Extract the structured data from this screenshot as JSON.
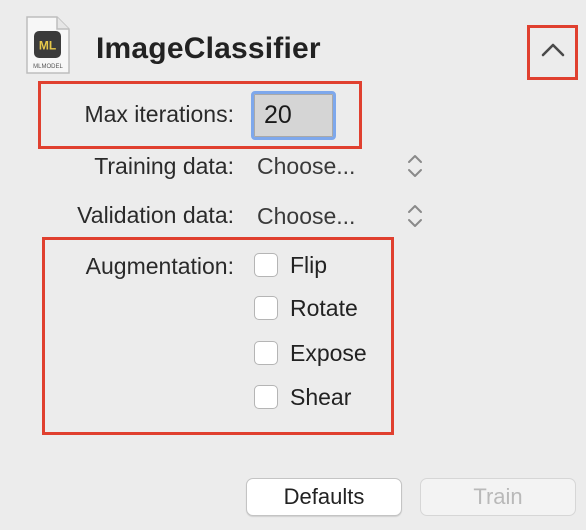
{
  "header": {
    "file_icon_badge": "ML",
    "file_icon_caption": "MLMODEL",
    "title": "ImageClassifier",
    "collapse_icon": "chevron-up-icon"
  },
  "form": {
    "max_iterations": {
      "label": "Max iterations:",
      "value": "20"
    },
    "training_data": {
      "label": "Training data:",
      "value": "Choose..."
    },
    "validation_data": {
      "label": "Validation data:",
      "value": "Choose..."
    },
    "augmentation": {
      "label": "Augmentation:",
      "options": [
        {
          "label": "Flip",
          "checked": false
        },
        {
          "label": "Rotate",
          "checked": false
        },
        {
          "label": "Expose",
          "checked": false
        },
        {
          "label": "Shear",
          "checked": false
        }
      ]
    }
  },
  "buttons": {
    "defaults": "Defaults",
    "train": "Train"
  },
  "colors": {
    "highlight": "#e0402f",
    "focus_ring": "#7ea8ec",
    "background": "#ececec",
    "icon_badge": "#e8c94a"
  }
}
